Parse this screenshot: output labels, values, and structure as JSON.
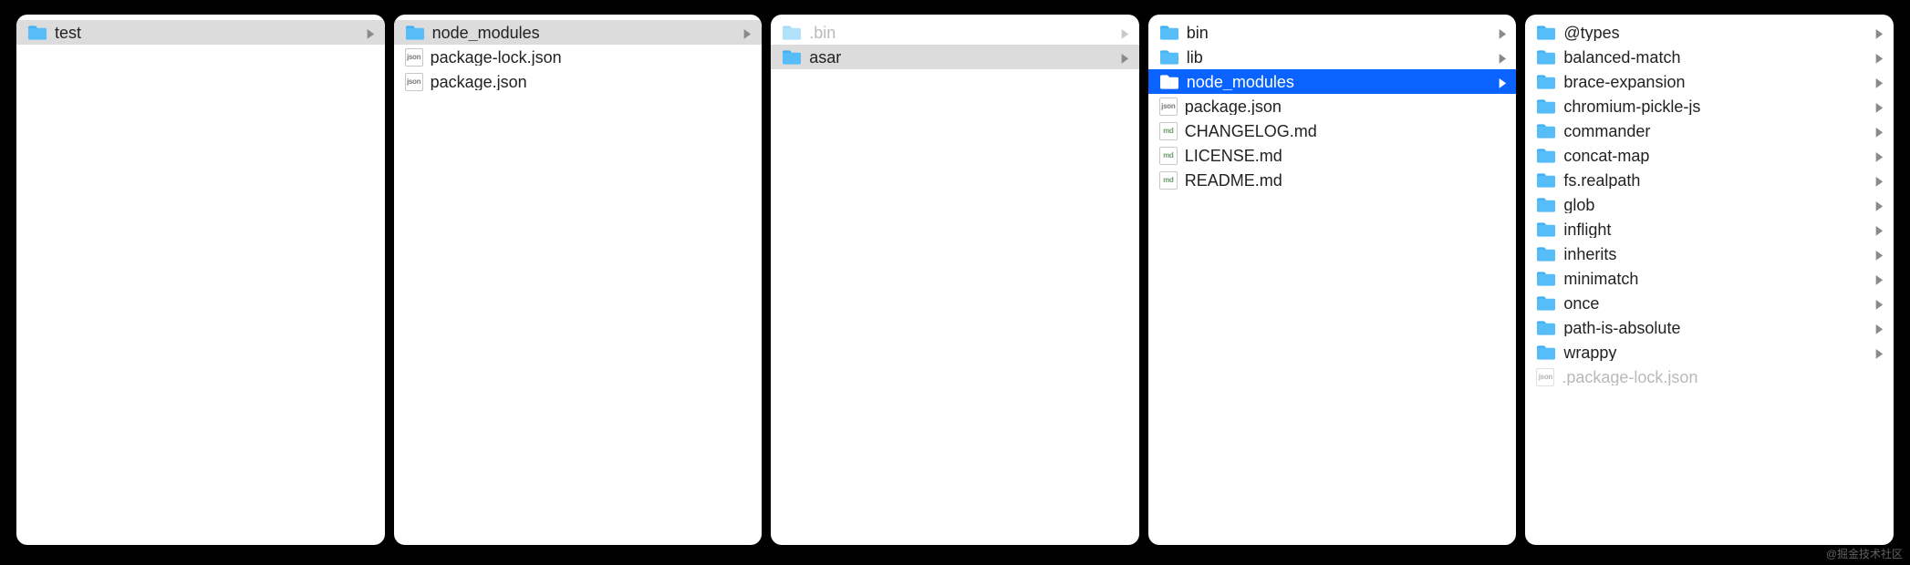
{
  "watermark": "@掘金技术社区",
  "columns": [
    {
      "items": [
        {
          "name": "test",
          "kind": "folder",
          "has_children": true,
          "state": "sel-grey"
        }
      ]
    },
    {
      "items": [
        {
          "name": "node_modules",
          "kind": "folder",
          "has_children": true,
          "state": "sel-grey"
        },
        {
          "name": "package-lock.json",
          "kind": "file",
          "badge": "json"
        },
        {
          "name": "package.json",
          "kind": "file",
          "badge": "json"
        }
      ]
    },
    {
      "items": [
        {
          "name": ".bin",
          "kind": "folder",
          "has_children": true,
          "dimmed": true
        },
        {
          "name": "asar",
          "kind": "folder",
          "has_children": true,
          "state": "sel-grey"
        }
      ]
    },
    {
      "items": [
        {
          "name": "bin",
          "kind": "folder",
          "has_children": true
        },
        {
          "name": "lib",
          "kind": "folder",
          "has_children": true
        },
        {
          "name": "node_modules",
          "kind": "folder",
          "has_children": true,
          "state": "sel-blue"
        },
        {
          "name": "package.json",
          "kind": "file",
          "badge": "json"
        },
        {
          "name": "CHANGELOG.md",
          "kind": "file",
          "badge": "md"
        },
        {
          "name": "LICENSE.md",
          "kind": "file",
          "badge": "md"
        },
        {
          "name": "README.md",
          "kind": "file",
          "badge": "md"
        }
      ]
    },
    {
      "items": [
        {
          "name": "@types",
          "kind": "folder",
          "has_children": true
        },
        {
          "name": "balanced-match",
          "kind": "folder",
          "has_children": true
        },
        {
          "name": "brace-expansion",
          "kind": "folder",
          "has_children": true
        },
        {
          "name": "chromium-pickle-js",
          "kind": "folder",
          "has_children": true
        },
        {
          "name": "commander",
          "kind": "folder",
          "has_children": true
        },
        {
          "name": "concat-map",
          "kind": "folder",
          "has_children": true
        },
        {
          "name": "fs.realpath",
          "kind": "folder",
          "has_children": true
        },
        {
          "name": "glob",
          "kind": "folder",
          "has_children": true
        },
        {
          "name": "inflight",
          "kind": "folder",
          "has_children": true
        },
        {
          "name": "inherits",
          "kind": "folder",
          "has_children": true
        },
        {
          "name": "minimatch",
          "kind": "folder",
          "has_children": true
        },
        {
          "name": "once",
          "kind": "folder",
          "has_children": true
        },
        {
          "name": "path-is-absolute",
          "kind": "folder",
          "has_children": true
        },
        {
          "name": "wrappy",
          "kind": "folder",
          "has_children": true
        },
        {
          "name": ".package-lock.json",
          "kind": "file",
          "badge": "json",
          "dimmed": true
        }
      ]
    }
  ]
}
